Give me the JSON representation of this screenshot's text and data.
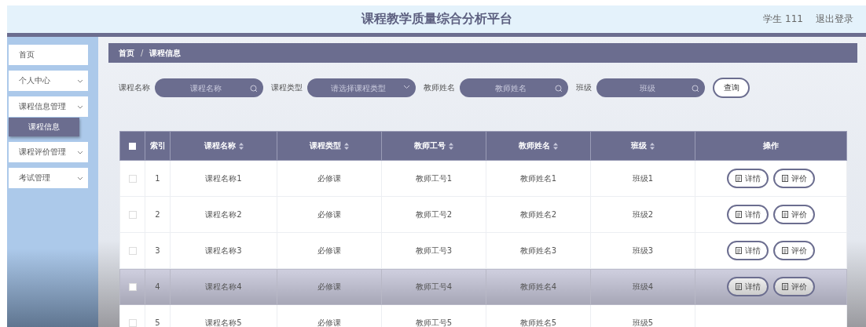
{
  "header": {
    "title": "课程教学质量综合分析平台",
    "user": "学生 111",
    "logout": "退出登录"
  },
  "sidebar": {
    "items": [
      {
        "label": "首页",
        "has_caret": false,
        "selected": false
      },
      {
        "label": "个人中心",
        "has_caret": true,
        "selected": false
      },
      {
        "label": "课程信息管理",
        "has_caret": true,
        "selected": false,
        "children": [
          {
            "label": "课程信息",
            "selected": true
          }
        ]
      },
      {
        "label": "课程评价管理",
        "has_caret": true,
        "selected": false
      },
      {
        "label": "考试管理",
        "has_caret": true,
        "selected": false
      }
    ]
  },
  "breadcrumb": {
    "items": [
      "首页",
      "课程信息"
    ],
    "separator": "/"
  },
  "filters": [
    {
      "label": "课程名称",
      "placeholder": "课程名称",
      "kind": "search"
    },
    {
      "label": "课程类型",
      "placeholder": "请选择课程类型",
      "kind": "select"
    },
    {
      "label": "教师姓名",
      "placeholder": "教师姓名",
      "kind": "search"
    },
    {
      "label": "班级",
      "placeholder": "班级",
      "kind": "search"
    }
  ],
  "query_button": "查询",
  "table": {
    "select_all_checked": false,
    "columns": [
      {
        "label": "索引",
        "sortable": false
      },
      {
        "label": "课程名称",
        "sortable": true
      },
      {
        "label": "课程类型",
        "sortable": true
      },
      {
        "label": "教师工号",
        "sortable": true
      },
      {
        "label": "教师姓名",
        "sortable": true
      },
      {
        "label": "班级",
        "sortable": true
      },
      {
        "label": "操作",
        "sortable": false
      }
    ],
    "rows": [
      {
        "cells": [
          "1",
          "课程名称1",
          "必修课",
          "教师工号1",
          "教师姓名1",
          "班级1"
        ],
        "checked": false,
        "highlighted": false,
        "actions": [
          "详情",
          "评价"
        ]
      },
      {
        "cells": [
          "2",
          "课程名称2",
          "必修课",
          "教师工号2",
          "教师姓名2",
          "班级2"
        ],
        "checked": false,
        "highlighted": false,
        "actions": [
          "详情",
          "评价"
        ]
      },
      {
        "cells": [
          "3",
          "课程名称3",
          "必修课",
          "教师工号3",
          "教师姓名3",
          "班级3"
        ],
        "checked": false,
        "highlighted": false,
        "actions": [
          "详情",
          "评价"
        ]
      },
      {
        "cells": [
          "4",
          "课程名称4",
          "必修课",
          "教师工号4",
          "教师姓名4",
          "班级4"
        ],
        "checked": false,
        "highlighted": true,
        "actions": [
          "详情",
          "评价"
        ]
      },
      {
        "cells": [
          "5",
          "课程名称5",
          "必修课",
          "教师工号5",
          "教师姓名5",
          "班级5"
        ],
        "checked": false,
        "highlighted": false,
        "actions": []
      }
    ]
  }
}
